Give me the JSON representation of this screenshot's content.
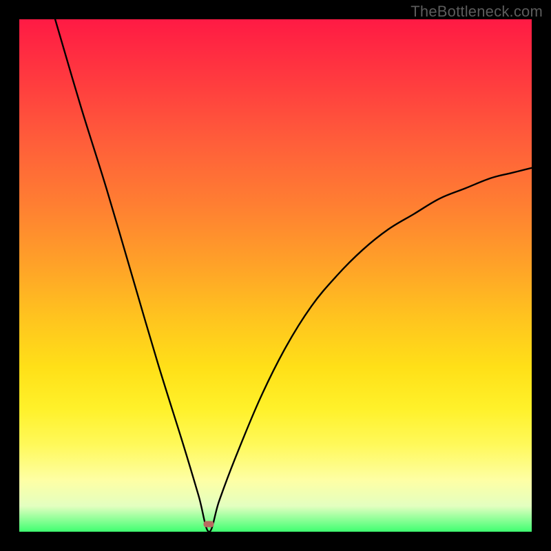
{
  "watermark": "TheBottleneck.com",
  "chart_data": {
    "type": "line",
    "title": "",
    "xlabel": "",
    "ylabel": "",
    "xlim": [
      0,
      100
    ],
    "ylim": [
      0,
      100
    ],
    "dip_x": 37,
    "dip_y": 0,
    "left_endpoint": {
      "x": 7,
      "y": 100
    },
    "right_endpoint": {
      "x": 100,
      "y": 71
    },
    "series": [
      {
        "name": "bottleneck-curve",
        "x": [
          7,
          12,
          17,
          22,
          27,
          32,
          35,
          37,
          39,
          42,
          47,
          52,
          57,
          62,
          67,
          72,
          77,
          82,
          87,
          92,
          96,
          100
        ],
        "y": [
          100,
          83,
          67,
          50,
          33,
          17,
          7,
          0,
          6,
          14,
          26,
          36,
          44,
          50,
          55,
          59,
          62,
          65,
          67,
          69,
          70,
          71
        ]
      }
    ],
    "marker": {
      "x": 37,
      "y": 1.5,
      "color": "#b96a60"
    },
    "background_gradient": {
      "top": "#ff1a44",
      "mid": "#ffe018",
      "bottom": "#3fff71"
    }
  }
}
